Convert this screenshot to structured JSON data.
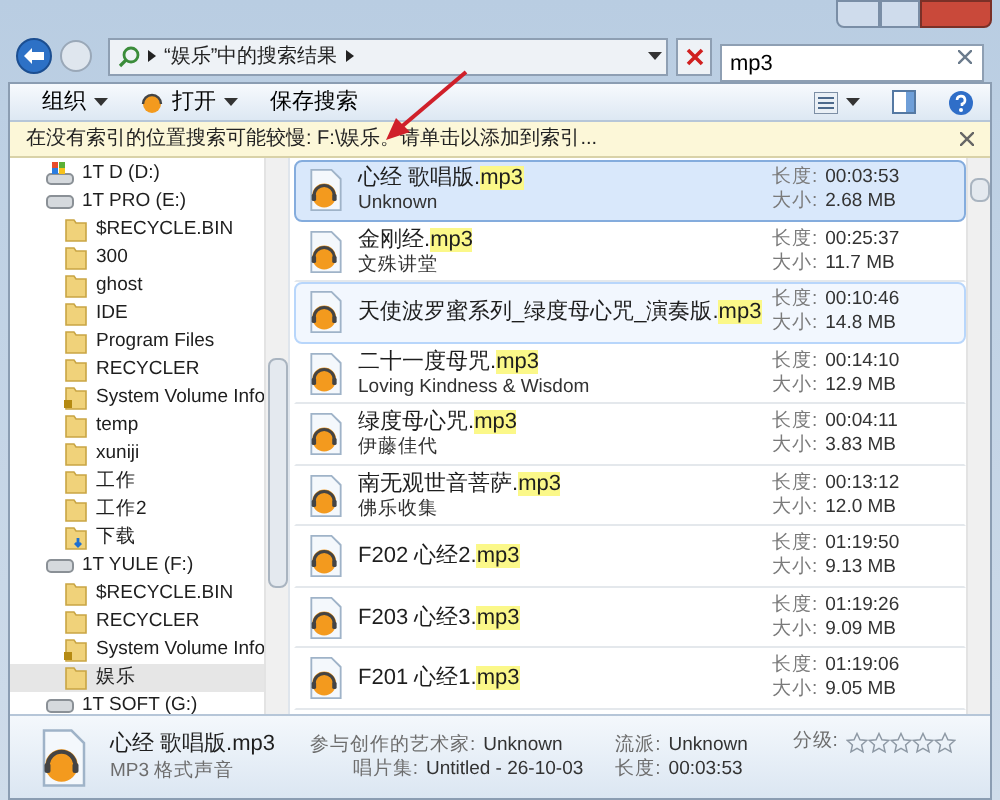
{
  "address_bar": {
    "location": "“娱乐”中的搜索结果",
    "search": {
      "value": "mp3"
    }
  },
  "toolbar": {
    "buttons": [
      {
        "kind": "menu",
        "label": "组织"
      },
      {
        "kind": "open",
        "label": "打开"
      },
      {
        "kind": "plain",
        "label": "保存搜索"
      }
    ]
  },
  "info_bar": {
    "message": "在没有索引的位置搜索可能较慢: F:\\娱乐。请单击以添加到索引..."
  },
  "sidebar": {
    "items": [
      {
        "kind": "system-drive",
        "label": "1T D (D:)",
        "selected": false
      },
      {
        "kind": "drive",
        "label": "1T PRO (E:)",
        "selected": false,
        "children": [
          {
            "kind": "folder",
            "label": "$RECYCLE.BIN",
            "selected": false
          },
          {
            "kind": "folder",
            "label": "300",
            "selected": false
          },
          {
            "kind": "folder",
            "label": "ghost",
            "selected": false
          },
          {
            "kind": "folder",
            "label": "IDE",
            "selected": false
          },
          {
            "kind": "folder",
            "label": "Program Files",
            "selected": false
          },
          {
            "kind": "folder",
            "label": "RECYCLER",
            "selected": false
          },
          {
            "kind": "locked-folder",
            "label": "System Volume Info",
            "selected": false
          },
          {
            "kind": "folder",
            "label": "temp",
            "selected": false
          },
          {
            "kind": "folder",
            "label": "xuniji",
            "selected": false
          },
          {
            "kind": "folder",
            "label": "工作",
            "selected": false
          },
          {
            "kind": "folder",
            "label": "工作2",
            "selected": false
          },
          {
            "kind": "download-folder",
            "label": "下载",
            "selected": false
          }
        ]
      },
      {
        "kind": "drive",
        "label": "1T YULE (F:)",
        "selected": false,
        "children": [
          {
            "kind": "folder",
            "label": "$RECYCLE.BIN",
            "selected": false
          },
          {
            "kind": "folder",
            "label": "RECYCLER",
            "selected": false
          },
          {
            "kind": "locked-folder",
            "label": "System Volume Info",
            "selected": false
          },
          {
            "kind": "folder",
            "label": "娱乐",
            "selected": true
          }
        ]
      },
      {
        "kind": "drive",
        "label": "1T SOFT (G:)",
        "selected": false
      }
    ]
  },
  "results": [
    {
      "name": "心经 歌唱版.",
      "match": "mp3",
      "artist": "Unknown",
      "length_label": "长度:",
      "length": "00:03:53",
      "size_label": "大小:",
      "size": "2.68 MB",
      "selected": true,
      "hovered": false
    },
    {
      "name": "金刚经.",
      "match": "mp3",
      "artist": "文殊讲堂",
      "length_label": "长度:",
      "length": "00:25:37",
      "size_label": "大小:",
      "size": "11.7 MB",
      "selected": false,
      "hovered": false
    },
    {
      "name": "天使波罗蜜系列_绿度母心咒_演奏版.",
      "match": "mp3",
      "length_label": "长度:",
      "length": "00:10:46",
      "size_label": "大小:",
      "size": "14.8 MB",
      "selected": false,
      "hovered": true
    },
    {
      "name": "二十一度母咒.",
      "match": "mp3",
      "artist": "Loving Kindness & Wisdom",
      "length_label": "长度:",
      "length": "00:14:10",
      "size_label": "大小:",
      "size": "12.9 MB",
      "selected": false,
      "hovered": false
    },
    {
      "name": "绿度母心咒.",
      "match": "mp3",
      "artist": "伊藤佳代",
      "length_label": "长度:",
      "length": "00:04:11",
      "size_label": "大小:",
      "size": "3.83 MB",
      "selected": false,
      "hovered": false
    },
    {
      "name": "南无观世音菩萨.",
      "match": "mp3",
      "artist": "佛乐收集",
      "length_label": "长度:",
      "length": "00:13:12",
      "size_label": "大小:",
      "size": "12.0 MB",
      "selected": false,
      "hovered": false
    },
    {
      "name": "F202 心经2.",
      "match": "mp3",
      "length_label": "长度:",
      "length": "01:19:50",
      "size_label": "大小:",
      "size": "9.13 MB",
      "selected": false,
      "hovered": false
    },
    {
      "name": "F203 心经3.",
      "match": "mp3",
      "length_label": "长度:",
      "length": "01:19:26",
      "size_label": "大小:",
      "size": "9.09 MB",
      "selected": false,
      "hovered": false
    },
    {
      "name": "F201 心经1.",
      "match": "mp3",
      "length_label": "长度:",
      "length": "01:19:06",
      "size_label": "大小:",
      "size": "9.05 MB",
      "selected": false,
      "hovered": false
    }
  ],
  "details": {
    "name": "心经 歌唱版.mp3",
    "type": "MP3 格式声音",
    "fields": [
      {
        "label": "参与创作的艺术家:",
        "value": "Unknown"
      },
      {
        "label": "唱片集:",
        "value": "Untitled - 26-10-03"
      },
      {
        "label": "流派:",
        "value": "Unknown"
      },
      {
        "label": "长度:",
        "value": "00:03:53"
      }
    ],
    "rating": {
      "label": "分级:",
      "stars": 0
    }
  }
}
